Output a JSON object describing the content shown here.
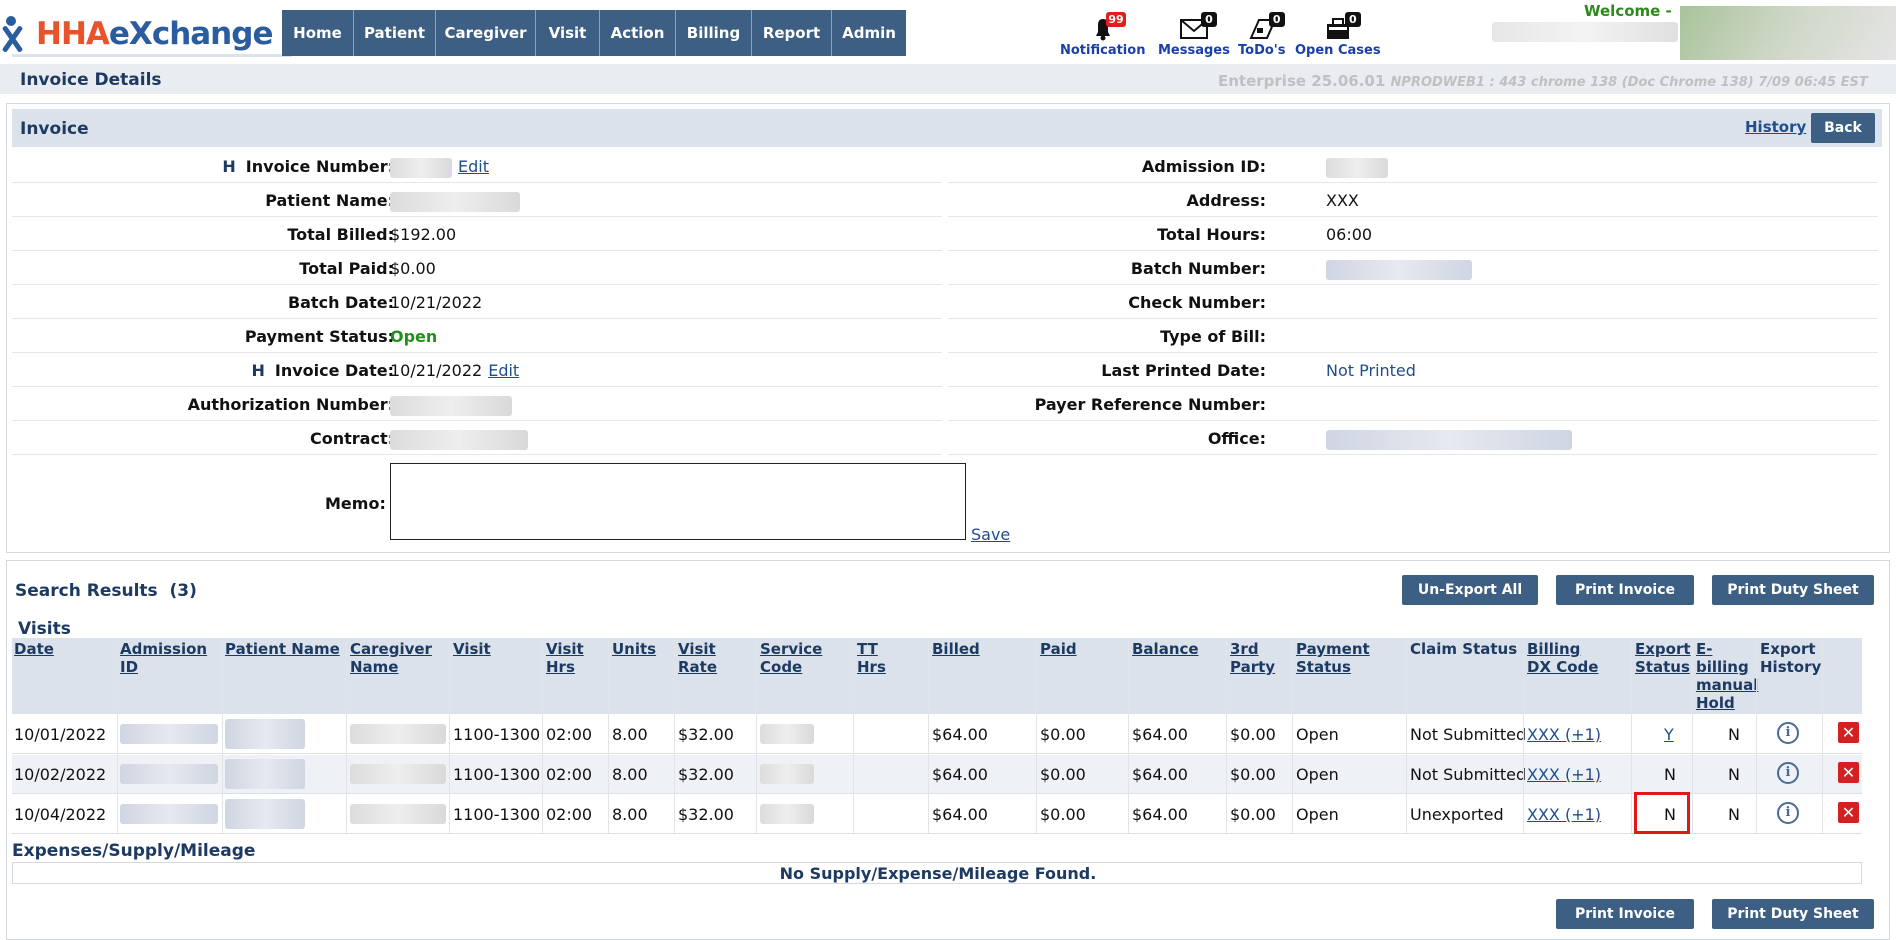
{
  "header": {
    "logo": {
      "part1": "HHA",
      "part2": "eXchange"
    },
    "nav": [
      "Home",
      "Patient",
      "Caregiver",
      "Visit",
      "Action",
      "Billing",
      "Report",
      "Admin"
    ],
    "notification": {
      "label": "Notification",
      "count": "99"
    },
    "messages": {
      "label": "Messages",
      "count": "0"
    },
    "todos": {
      "label": "ToDo's",
      "count": "0"
    },
    "open_cases": {
      "label": "Open Cases",
      "count": "0"
    },
    "welcome": "Welcome -"
  },
  "title_bar": {
    "title": "Invoice Details",
    "version": "Enterprise 25.06.01",
    "version_detail": "NPRODWEB1 : 443 chrome 138 (Doc Chrome 138) 7/09 06:45 EST"
  },
  "invoice": {
    "heading": "Invoice",
    "history_label": "History",
    "back_label": "Back",
    "h_marker": "H",
    "edit_label": "Edit",
    "left": {
      "invoice_number_label": "Invoice Number:",
      "patient_name_label": "Patient Name:",
      "total_billed_label": "Total Billed:",
      "total_billed": "$192.00",
      "total_paid_label": "Total Paid:",
      "total_paid": "$0.00",
      "batch_date_label": "Batch Date:",
      "batch_date": "10/21/2022",
      "payment_status_label": "Payment Status:",
      "payment_status": "Open",
      "invoice_date_label": "Invoice Date:",
      "invoice_date": "10/21/2022",
      "authorization_number_label": "Authorization Number:",
      "contract_label": "Contract:"
    },
    "right": {
      "admission_id_label": "Admission ID:",
      "address_label": "Address:",
      "address": "XXX",
      "total_hours_label": "Total Hours:",
      "total_hours": "06:00",
      "batch_number_label": "Batch Number:",
      "check_number_label": "Check Number:",
      "type_of_bill_label": "Type of Bill:",
      "last_printed_date_label": "Last Printed Date:",
      "last_printed_date": "Not Printed",
      "payer_reference_number_label": "Payer Reference Number:",
      "office_label": "Office:"
    },
    "memo_label": "Memo:",
    "memo_value": "",
    "save_label": "Save"
  },
  "results": {
    "title": "Search Results",
    "count": "(3)",
    "unexport_all_label": "Un-Export All",
    "print_invoice_label": "Print Invoice",
    "print_duty_sheet_label": "Print Duty Sheet",
    "visits_label": "Visits",
    "columns": [
      {
        "l1": "Date",
        "l2": "",
        "l3": "",
        "l4": ""
      },
      {
        "l1": "Admission",
        "l2": "ID",
        "l3": "",
        "l4": ""
      },
      {
        "l1": "Patient Name",
        "l2": "",
        "l3": "",
        "l4": ""
      },
      {
        "l1": "Caregiver",
        "l2": "Name",
        "l3": "",
        "l4": ""
      },
      {
        "l1": "Visit",
        "l2": "",
        "l3": "",
        "l4": ""
      },
      {
        "l1": "Visit",
        "l2": "Hrs",
        "l3": "",
        "l4": ""
      },
      {
        "l1": "Units",
        "l2": "",
        "l3": "",
        "l4": ""
      },
      {
        "l1": "Visit",
        "l2": "Rate",
        "l3": "",
        "l4": ""
      },
      {
        "l1": "Service",
        "l2": "Code",
        "l3": "",
        "l4": ""
      },
      {
        "l1": "TT",
        "l2": "Hrs",
        "l3": "",
        "l4": ""
      },
      {
        "l1": "Billed",
        "l2": "",
        "l3": "",
        "l4": ""
      },
      {
        "l1": "Paid",
        "l2": "",
        "l3": "",
        "l4": ""
      },
      {
        "l1": "Balance",
        "l2": "",
        "l3": "",
        "l4": ""
      },
      {
        "l1": "3rd",
        "l2": "Party",
        "l3": "",
        "l4": ""
      },
      {
        "l1": "Payment",
        "l2": "Status",
        "l3": "",
        "l4": ""
      },
      {
        "l1": "Claim Status",
        "l2": "",
        "l3": "",
        "l4": ""
      },
      {
        "l1": "Billing",
        "l2": "DX Code",
        "l3": "",
        "l4": ""
      },
      {
        "l1": "Export",
        "l2": "Status",
        "l3": "",
        "l4": ""
      },
      {
        "l1": "E-",
        "l2": "billing",
        "l3": "manual",
        "l4": "Hold"
      },
      {
        "l1": "Export",
        "l2": "History",
        "l3": "",
        "l4": ""
      }
    ],
    "rows": [
      {
        "date": "10/01/2022",
        "visit": "1100-1300",
        "visit_hrs": "02:00",
        "units": "8.00",
        "visit_rate": "$32.00",
        "billed": "$64.00",
        "paid": "$0.00",
        "balance": "$64.00",
        "third_party": "$0.00",
        "payment_status": "Open",
        "claim_status": "Not Submitted",
        "billing_dx": "XXX (+1)",
        "export_status": "Y",
        "ebilling_hold": "N"
      },
      {
        "date": "10/02/2022",
        "visit": "1100-1300",
        "visit_hrs": "02:00",
        "units": "8.00",
        "visit_rate": "$32.00",
        "billed": "$64.00",
        "paid": "$0.00",
        "balance": "$64.00",
        "third_party": "$0.00",
        "payment_status": "Open",
        "claim_status": "Not Submitted",
        "billing_dx": "XXX (+1)",
        "export_status": "N",
        "ebilling_hold": "N"
      },
      {
        "date": "10/04/2022",
        "visit": "1100-1300",
        "visit_hrs": "02:00",
        "units": "8.00",
        "visit_rate": "$32.00",
        "billed": "$64.00",
        "paid": "$0.00",
        "balance": "$64.00",
        "third_party": "$0.00",
        "payment_status": "Open",
        "claim_status": "Unexported",
        "billing_dx": "XXX (+1)",
        "export_status": "N",
        "ebilling_hold": "N"
      }
    ],
    "expenses_label": "Expenses/Supply/Mileage",
    "expenses_empty": "No Supply/Expense/Mileage Found."
  },
  "colors": {
    "nav_bg": "#3c5f83",
    "header_bg": "#dbe2ec",
    "open_green": "#1f9318",
    "alert_red": "#e21d1d",
    "welcome_green": "#2c8a1c"
  },
  "icons": [
    "bell-icon",
    "envelope-icon",
    "todo-icon",
    "open-cases-icon",
    "info-icon",
    "delete-icon"
  ]
}
